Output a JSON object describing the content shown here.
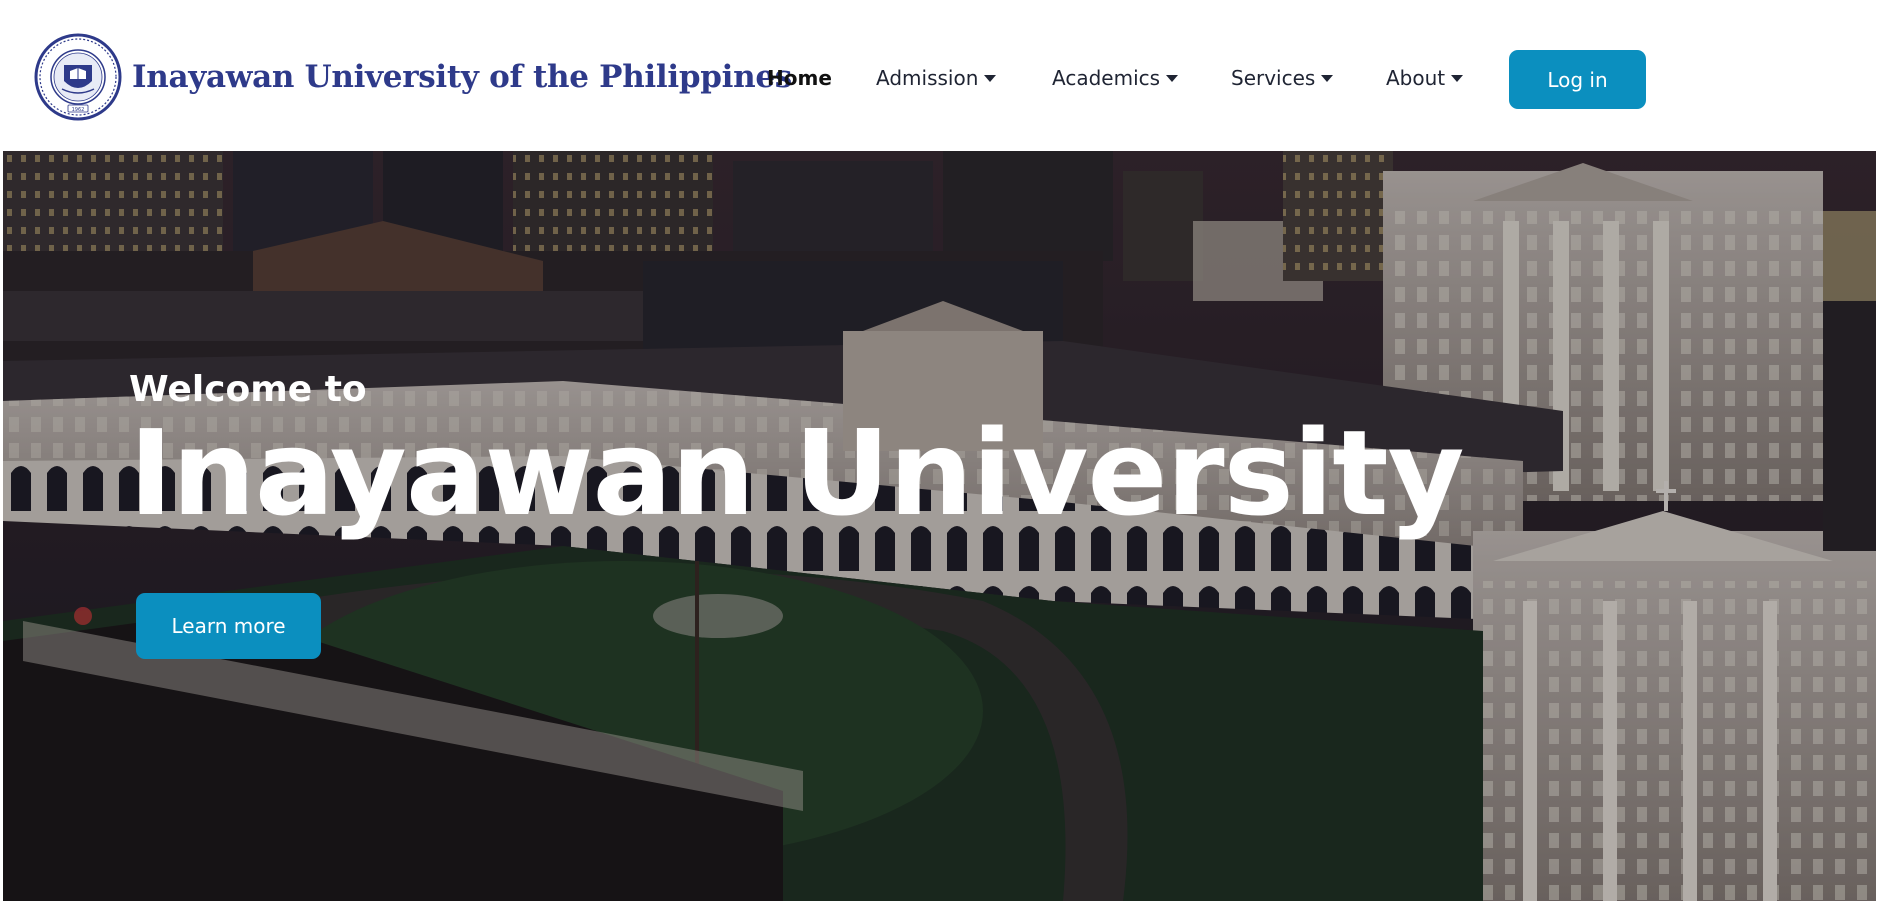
{
  "header": {
    "brand_name": "Inayawan University of the Philippines",
    "seal_year": "1962",
    "nav": [
      {
        "label": "Home",
        "active": true,
        "dropdown": false
      },
      {
        "label": "Admission",
        "active": false,
        "dropdown": true
      },
      {
        "label": "Academics",
        "active": false,
        "dropdown": true
      },
      {
        "label": "Services",
        "active": false,
        "dropdown": true
      },
      {
        "label": "About",
        "active": false,
        "dropdown": true
      }
    ],
    "login_label": "Log in"
  },
  "hero": {
    "welcome": "Welcome to",
    "title": "Inayawan University",
    "cta_label": "Learn more"
  },
  "colors": {
    "brand": "#2e3a8a",
    "accent": "#0b8fbf",
    "text": "#1f2433"
  }
}
